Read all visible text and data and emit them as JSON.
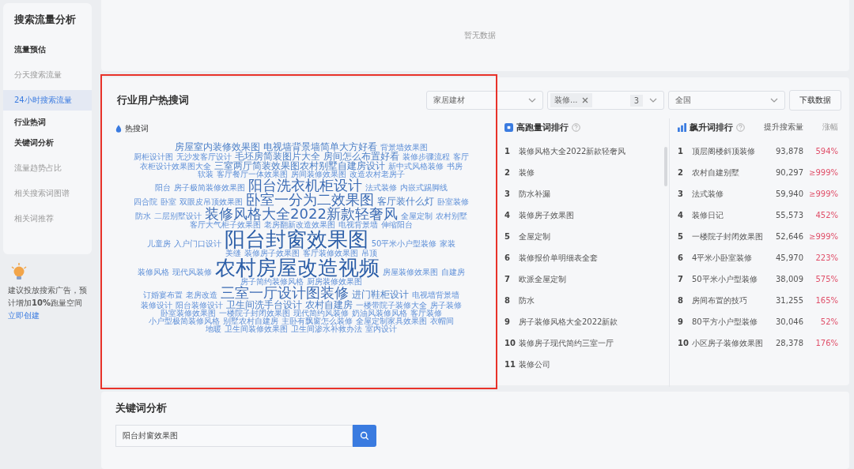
{
  "sidebar": {
    "title": "搜索流量分析",
    "groups": [
      {
        "title": "流量预估",
        "items": [
          {
            "label": "分天搜索流量",
            "selected": false
          },
          {
            "label": "24小时搜索流量",
            "selected": true
          }
        ]
      },
      {
        "title": "行业热词"
      },
      {
        "title": "关键词分析",
        "items": [
          {
            "label": "流量趋势占比",
            "selected": false
          },
          {
            "label": "相关搜索词图谱",
            "selected": false
          },
          {
            "label": "相关词推荐",
            "selected": false
          }
        ]
      }
    ],
    "tip": {
      "text": "建议投放搜索广告，预计增加**10%**跑量空间",
      "link": "立即创建"
    }
  },
  "top_panel": {
    "empty_text": "暂无数据"
  },
  "hot_words": {
    "title": "行业用户热搜词",
    "filters": {
      "category": "家居建材",
      "tag": "装修...",
      "tag_count": "3",
      "region": "全国",
      "download": "下载数据"
    },
    "cloud_legend": "热搜词",
    "cloud_rows": [
      {
        "words": [
          {
            "text": "房屋室内装修效果图",
            "kind": "m"
          },
          {
            "text": "电视墙背景墙简单大方好看",
            "kind": "m"
          },
          {
            "text": "背景墙效果图",
            "kind": "s"
          }
        ]
      },
      {
        "words": [
          {
            "text": "厨柜设计图",
            "kind": "s"
          },
          {
            "text": "无沙发客厅设计",
            "kind": "s"
          },
          {
            "text": "毛坯房简装图片大全",
            "kind": "m"
          },
          {
            "text": "房间怎么布置好看",
            "kind": "m"
          },
          {
            "text": "装修步骤流程",
            "kind": "s"
          },
          {
            "text": "客厅",
            "kind": "s"
          }
        ]
      },
      {
        "words": [
          {
            "text": "衣柜设计效果图大全",
            "kind": "s"
          },
          {
            "text": "三室两厅简装效果图农村别墅自建房设计",
            "kind": "m"
          },
          {
            "text": "新中式风格装修",
            "kind": "s"
          },
          {
            "text": "书房",
            "kind": "s"
          }
        ]
      },
      {
        "words": [
          {
            "text": "软装",
            "kind": "s"
          },
          {
            "text": "客厅餐厅一体效果图",
            "kind": "s"
          },
          {
            "text": "房间装修效果图",
            "kind": "s"
          },
          {
            "text": "改造农村老房子",
            "kind": "s"
          }
        ]
      },
      {
        "words": [
          {
            "text": "阳台",
            "kind": "s"
          },
          {
            "text": "房子极简装修效果图",
            "kind": "s"
          },
          {
            "text": "阳台洗衣机柜设计",
            "kind": "l"
          },
          {
            "text": "法式装修",
            "kind": "s"
          },
          {
            "text": "内嵌式踢脚线",
            "kind": "s"
          }
        ]
      },
      {
        "words": [
          {
            "text": "四合院",
            "kind": "s"
          },
          {
            "text": "卧室",
            "kind": "s"
          },
          {
            "text": "双眼皮吊顶效果图",
            "kind": "s"
          },
          {
            "text": "卧室一分为二效果图",
            "kind": "l"
          },
          {
            "text": "客厅装什么灯",
            "kind": "m"
          },
          {
            "text": "卧室装修",
            "kind": "s"
          }
        ]
      },
      {
        "words": [
          {
            "text": "防水",
            "kind": "s"
          },
          {
            "text": "二层别墅设计",
            "kind": "s"
          },
          {
            "text": "装修风格大全2022新款轻奢风",
            "kind": "l"
          },
          {
            "text": "全屋定制",
            "kind": "s"
          },
          {
            "text": "农村别墅",
            "kind": "s"
          }
        ]
      },
      {
        "words": [
          {
            "text": "客厅大气柜子效果图",
            "kind": "s"
          },
          {
            "text": "老房翻新改造效果图",
            "kind": "s"
          },
          {
            "text": "电视背景墙",
            "kind": "s"
          },
          {
            "text": "伸缩阳台",
            "kind": "s"
          }
        ]
      },
      {
        "words": [
          {
            "text": "儿童房",
            "kind": "s"
          },
          {
            "text": "入户门口设计",
            "kind": "s"
          },
          {
            "text": "阳台封窗效果图",
            "kind": "xl"
          },
          {
            "text": "50平米小户型装修",
            "kind": "s"
          },
          {
            "text": "家装",
            "kind": "s"
          }
        ]
      },
      {
        "words": [
          {
            "text": "美缝",
            "kind": "s"
          },
          {
            "text": "装修房子效果图",
            "kind": "s"
          },
          {
            "text": "客厅装修效果图",
            "kind": "s"
          },
          {
            "text": "吊顶",
            "kind": "s"
          }
        ]
      },
      {
        "words": [
          {
            "text": "装修风格",
            "kind": "s"
          },
          {
            "text": "现代风装修",
            "kind": "s"
          },
          {
            "text": "农村房屋改造视频",
            "kind": "xl"
          },
          {
            "text": "房屋装修效果图",
            "kind": "s"
          },
          {
            "text": "自建房",
            "kind": "s"
          }
        ]
      },
      {
        "words": [
          {
            "text": "房子简约装修风格",
            "kind": "s"
          },
          {
            "text": "厨房装修效果图",
            "kind": "s"
          }
        ]
      },
      {
        "words": [
          {
            "text": "订婚宴布置",
            "kind": "s"
          },
          {
            "text": "老房改造",
            "kind": "s"
          },
          {
            "text": "三室一厅设计图装修",
            "kind": "l"
          },
          {
            "text": "进门鞋柜设计",
            "kind": "m"
          },
          {
            "text": "电视墙背景墙",
            "kind": "s"
          }
        ]
      },
      {
        "words": [
          {
            "text": "装修设计",
            "kind": "s"
          },
          {
            "text": "阳台装修设计",
            "kind": "s"
          },
          {
            "text": "卫生间洗手台设计",
            "kind": "m"
          },
          {
            "text": "农村自建房",
            "kind": "m"
          },
          {
            "text": "一楼带院子装修大全",
            "kind": "s"
          },
          {
            "text": "房子装修",
            "kind": "s"
          }
        ]
      },
      {
        "words": [
          {
            "text": "卧室装修效果图",
            "kind": "s"
          },
          {
            "text": "一楼院子封闭效果图",
            "kind": "s"
          },
          {
            "text": "现代简约风装修",
            "kind": "s"
          },
          {
            "text": "奶油风装修风格",
            "kind": "s"
          },
          {
            "text": "客厅装修",
            "kind": "s"
          }
        ]
      },
      {
        "words": [
          {
            "text": "小户型极简装修风格",
            "kind": "s"
          },
          {
            "text": "别墅农村自建房",
            "kind": "s"
          },
          {
            "text": "主卧有飘窗怎么装修",
            "kind": "s"
          },
          {
            "text": "全屋定制家具效果图",
            "kind": "s"
          },
          {
            "text": "衣帽间",
            "kind": "s"
          }
        ]
      },
      {
        "words": [
          {
            "text": "地暖",
            "kind": "s"
          },
          {
            "text": "卫生间装修效果图",
            "kind": "s"
          },
          {
            "text": "卫生间渗水补救办法",
            "kind": "s"
          },
          {
            "text": "室内设计",
            "kind": "s"
          }
        ]
      }
    ],
    "top_volume": {
      "title": "高跑量词排行",
      "rows": [
        {
          "rank": "1",
          "keyword": "装修风格大全2022新款轻奢风"
        },
        {
          "rank": "2",
          "keyword": "装修"
        },
        {
          "rank": "3",
          "keyword": "防水补漏"
        },
        {
          "rank": "4",
          "keyword": "装修房子效果图"
        },
        {
          "rank": "5",
          "keyword": "全屋定制"
        },
        {
          "rank": "6",
          "keyword": "装修报价单明细表全套"
        },
        {
          "rank": "7",
          "keyword": "欧派全屋定制"
        },
        {
          "rank": "8",
          "keyword": "防水"
        },
        {
          "rank": "9",
          "keyword": "房子装修风格大全2022新款"
        },
        {
          "rank": "10",
          "keyword": "装修房子现代简约三室一厅"
        },
        {
          "rank": "11",
          "keyword": "装修公司"
        }
      ]
    },
    "rising": {
      "title": "飙升词排行",
      "columns": [
        "提升搜索量",
        "涨幅"
      ],
      "rows": [
        {
          "rank": "1",
          "keyword": "顶层阁楼斜顶装修",
          "volume": "93,878",
          "change": "594%"
        },
        {
          "rank": "2",
          "keyword": "农村自建别墅",
          "volume": "90,297",
          "change": "≥999%"
        },
        {
          "rank": "3",
          "keyword": "法式装修",
          "volume": "59,940",
          "change": "≥999%"
        },
        {
          "rank": "4",
          "keyword": "装修日记",
          "volume": "55,573",
          "change": "452%"
        },
        {
          "rank": "5",
          "keyword": "一楼院子封闭效果图",
          "volume": "52,646",
          "change": "≥999%"
        },
        {
          "rank": "6",
          "keyword": "4平米小卧室装修",
          "volume": "45,970",
          "change": "223%"
        },
        {
          "rank": "7",
          "keyword": "50平米小户型装修",
          "volume": "38,009",
          "change": "575%"
        },
        {
          "rank": "8",
          "keyword": "房间布置的技巧",
          "volume": "31,255",
          "change": "165%"
        },
        {
          "rank": "9",
          "keyword": "80平方小户型装修",
          "volume": "30,046",
          "change": "52%"
        },
        {
          "rank": "10",
          "keyword": "小区房子装修效果图",
          "volume": "28,378",
          "change": "176%"
        }
      ]
    }
  },
  "keyword_analysis": {
    "title": "关键词分析",
    "search_value": "阳台封窗效果图"
  }
}
